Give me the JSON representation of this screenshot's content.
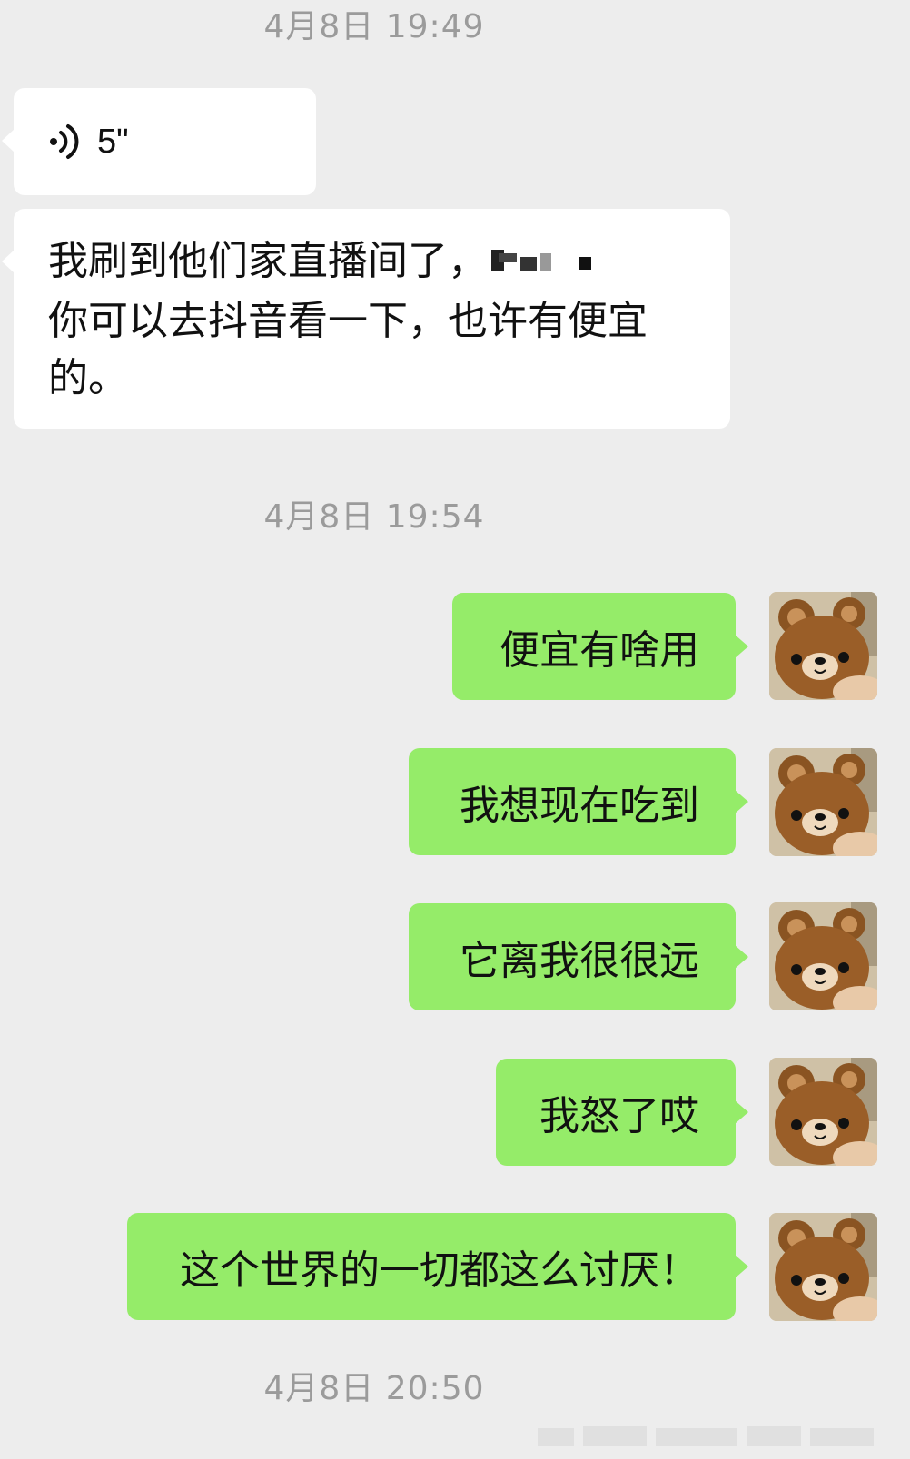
{
  "chat": {
    "timestamps": [
      "4月8日 19:49",
      "4月8日 19:54",
      "4月8日 20:50"
    ],
    "incoming": {
      "voice_duration": "5\"",
      "text_line1": "我刷到他们家直播间了，",
      "text_line2": "你可以去抖音看一下，也许有便宜",
      "text_line3": "的。"
    },
    "outgoing": [
      "便宜有啥用",
      "我想现在吃到",
      "它离我很很远",
      "我怒了哎",
      "这个世界的一切都这么讨厌！"
    ]
  },
  "colors": {
    "background": "#ededed",
    "incoming_bubble": "#ffffff",
    "outgoing_bubble": "#95ec69",
    "timestamp_text": "#9b9b9b"
  },
  "icons": {
    "voice": "voice-wave-icon",
    "avatar": "teddy-bear-avatar"
  }
}
